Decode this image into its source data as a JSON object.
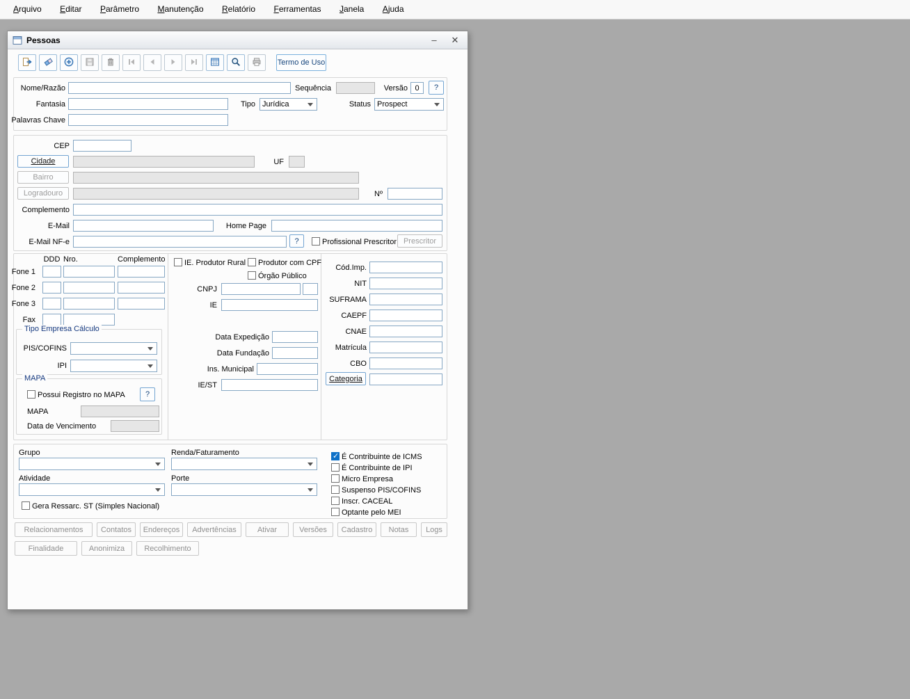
{
  "menubar": {
    "items": [
      "Arquivo",
      "Editar",
      "Parâmetro",
      "Manutenção",
      "Relatório",
      "Ferramentas",
      "Janela",
      "Ajuda"
    ]
  },
  "window": {
    "title": "Pessoas",
    "minimize_glyph": "–",
    "close_glyph": "✕"
  },
  "toolbar": {
    "icons": [
      "exit-icon",
      "eraser-icon",
      "add-record-icon",
      "save-icon",
      "delete-icon",
      "first-record-icon",
      "previous-record-icon",
      "next-record-icon",
      "last-record-icon",
      "grid-icon",
      "search-icon",
      "print-icon"
    ],
    "termo_de_uso_label": "Termo de Uso"
  },
  "identity": {
    "nome_razao_label": "Nome/Razão",
    "sequencia_label": "Sequência",
    "versao_label": "Versão",
    "versao_value": "0",
    "versao_help_label": "?",
    "fantasia_label": "Fantasia",
    "tipo_label": "Tipo",
    "tipo_value": "Jurídica",
    "status_label": "Status",
    "status_value": "Prospect",
    "palavras_chave_label": "Palavras Chave"
  },
  "address": {
    "cep_label": "CEP",
    "cidade_button_label": "Cidade",
    "uf_label": "UF",
    "bairro_button_label": "Bairro",
    "logradouro_button_label": "Logradouro",
    "numero_label": "Nº",
    "complemento_label": "Complemento",
    "email_label": "E-Mail",
    "home_page_label": "Home Page",
    "email_nfe_label": "E-Mail NF-e",
    "email_nfe_help_label": "?",
    "profissional_prescritor_label": "Profissional Prescritor",
    "profissional_prescritor_checked": false,
    "prescritor_button_label": "Prescritor"
  },
  "phones": {
    "ddd_header": "DDD",
    "nro_header": "Nro.",
    "complemento_header": "Complemento",
    "fone1_label": "Fone 1",
    "fone2_label": "Fone 2",
    "fone3_label": "Fone 3",
    "fax_label": "Fax"
  },
  "tipo_empresa_calculo": {
    "title": "Tipo Empresa Cálculo",
    "pis_cofins_label": "PIS/COFINS",
    "ipi_label": "IPI"
  },
  "mapa": {
    "title": "MAPA",
    "possui_registro_label": "Possui Registro no MAPA",
    "possui_registro_checked": false,
    "help_label": "?",
    "mapa_label": "MAPA",
    "data_vencimento_label": "Data de Vencimento"
  },
  "fiscal": {
    "ie_produtor_rural_label": "IE. Produtor Rural",
    "ie_produtor_rural_checked": false,
    "produtor_com_cpf_label": "Produtor com CPF",
    "produtor_com_cpf_checked": false,
    "orgao_publico_label": "Órgão Público",
    "orgao_publico_checked": false,
    "cnpj_label": "CNPJ",
    "ie_label": "IE",
    "data_expedicao_label": "Data Expedição",
    "data_fundacao_label": "Data Fundação",
    "ins_municipal_label": "Ins. Municipal",
    "ie_st_label": "IE/ST"
  },
  "codes": {
    "cod_imp_label": "Cód.Imp.",
    "nit_label": "NIT",
    "suframa_label": "SUFRAMA",
    "caepf_label": "CAEPF",
    "cnae_label": "CNAE",
    "matricula_label": "Matrícula",
    "cbo_label": "CBO",
    "categoria_button_label": "Categoria"
  },
  "classification": {
    "grupo_label": "Grupo",
    "renda_faturamento_label": "Renda/Faturamento",
    "atividade_label": "Atividade",
    "porte_label": "Porte",
    "gera_ressarc_label": "Gera Ressarc. ST (Simples Nacional)",
    "gera_ressarc_checked": false,
    "flags": [
      {
        "label": "É Contribuinte de ICMS",
        "checked": true
      },
      {
        "label": "É Contribuinte de IPI",
        "checked": false
      },
      {
        "label": "Micro Empresa",
        "checked": false
      },
      {
        "label": "Suspenso PIS/COFINS",
        "checked": false
      },
      {
        "label": "Inscr. CACEAL",
        "checked": false
      },
      {
        "label": "Optante pelo MEI",
        "checked": false
      }
    ]
  },
  "footer": {
    "row1": [
      "Relacionamentos",
      "Contatos",
      "Endereços",
      "Advertências",
      "Ativar",
      "Versões",
      "Cadastro",
      "Notas",
      "Logs"
    ],
    "row2": [
      "Finalidade",
      "Anonimiza",
      "Recolhimento"
    ]
  }
}
